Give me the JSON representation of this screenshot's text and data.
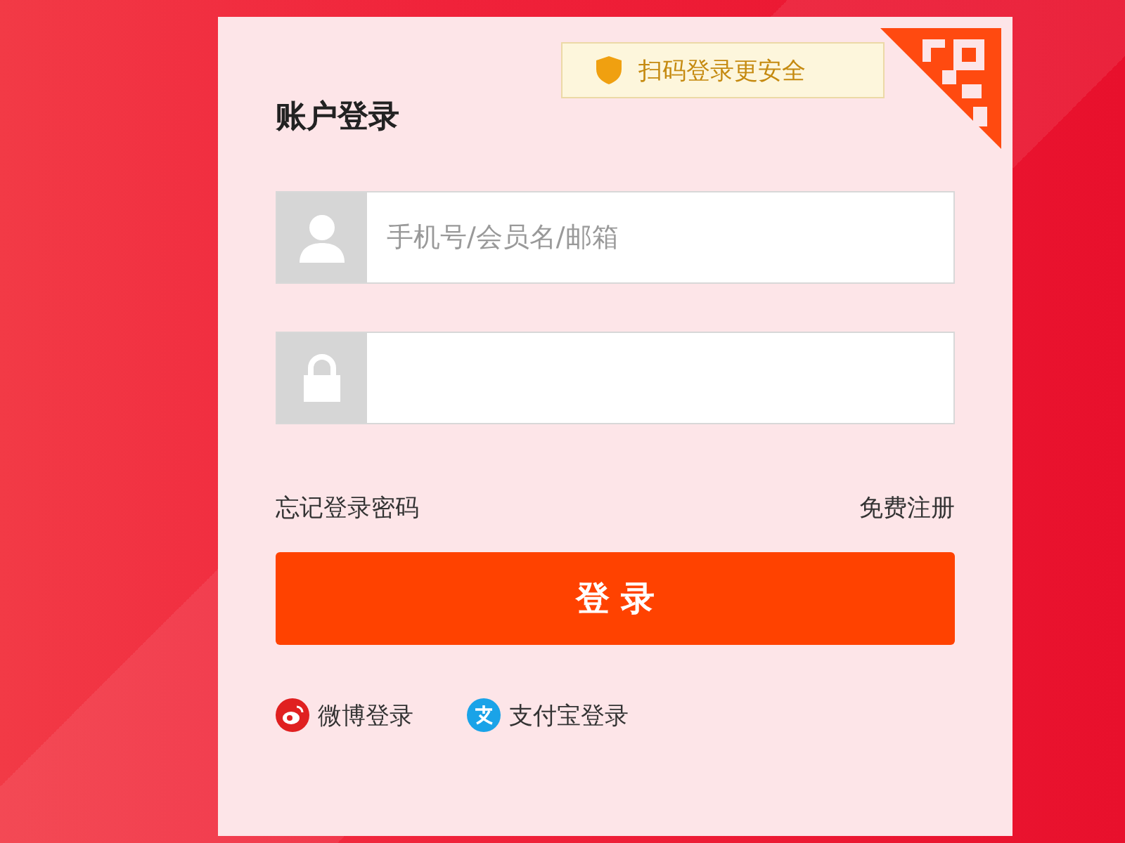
{
  "qr_tip": "扫码登录更安全",
  "title": "账户登录",
  "fields": [
    {
      "kind": "user",
      "placeholder": "手机号/会员名/邮箱"
    },
    {
      "kind": "password"
    }
  ],
  "forgot_link": "忘记登录密码",
  "register_link": "免费注册",
  "login_button": "登 录",
  "social": [
    {
      "kind": "weibo",
      "label": "微博登录"
    },
    {
      "kind": "alipay",
      "label": "支付宝登录"
    }
  ]
}
